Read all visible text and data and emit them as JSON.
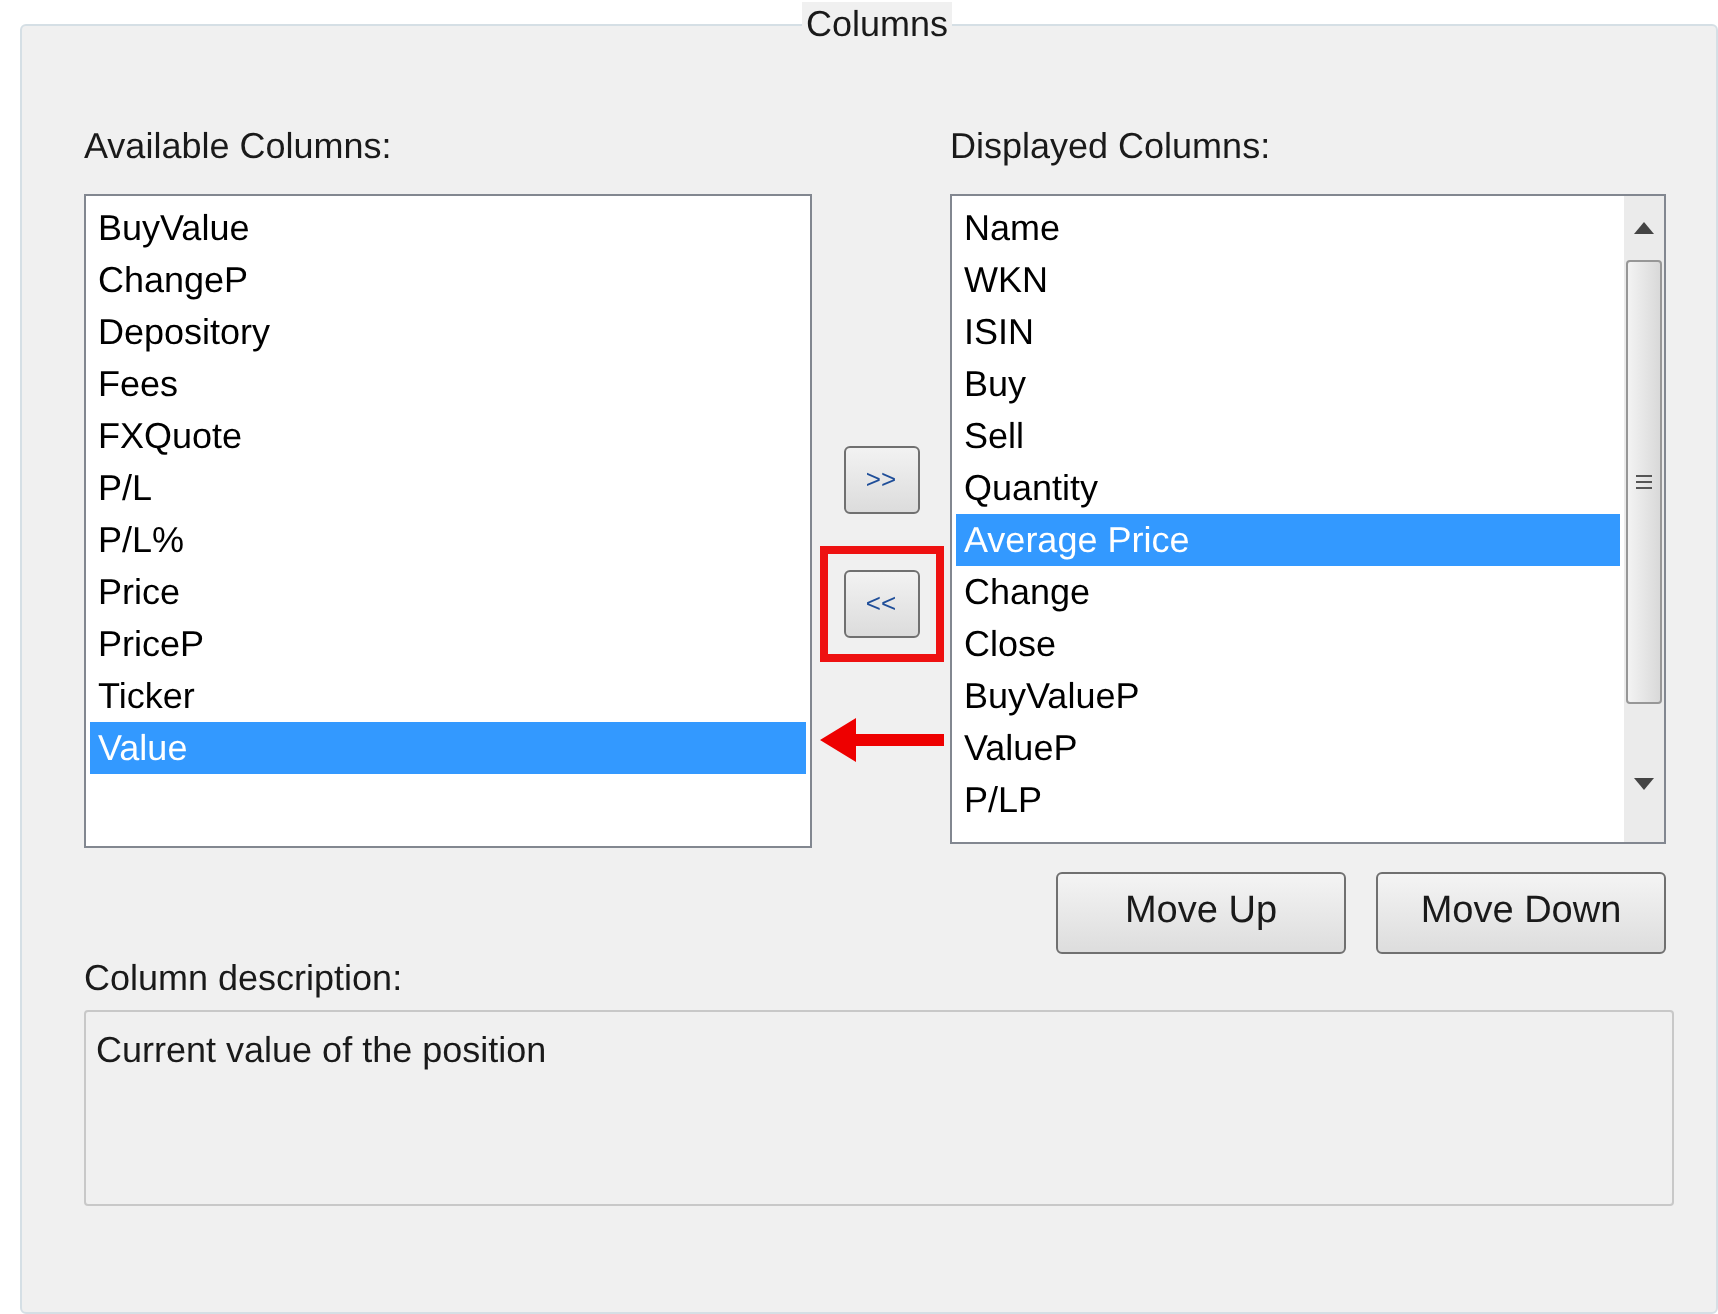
{
  "group_title": "Columns",
  "available": {
    "label": "Available Columns:",
    "items": [
      {
        "label": "BuyValue",
        "selected": false
      },
      {
        "label": "ChangeP",
        "selected": false
      },
      {
        "label": "Depository",
        "selected": false
      },
      {
        "label": "Fees",
        "selected": false
      },
      {
        "label": "FXQuote",
        "selected": false
      },
      {
        "label": "P/L",
        "selected": false
      },
      {
        "label": "P/L%",
        "selected": false
      },
      {
        "label": "Price",
        "selected": false
      },
      {
        "label": "PriceP",
        "selected": false
      },
      {
        "label": "Ticker",
        "selected": false
      },
      {
        "label": "Value",
        "selected": true
      }
    ]
  },
  "transfer_buttons": [
    {
      "label": ">>",
      "highlighted": false
    },
    {
      "label": "<<",
      "highlighted": true
    }
  ],
  "displayed": {
    "label": "Displayed Columns:",
    "items": [
      {
        "label": "Name",
        "selected": false
      },
      {
        "label": "WKN",
        "selected": false
      },
      {
        "label": "ISIN",
        "selected": false
      },
      {
        "label": "Buy",
        "selected": false
      },
      {
        "label": "Sell",
        "selected": false
      },
      {
        "label": "Quantity",
        "selected": false
      },
      {
        "label": "Average Price",
        "selected": true
      },
      {
        "label": "Change",
        "selected": false
      },
      {
        "label": "Close",
        "selected": false
      },
      {
        "label": "BuyValueP",
        "selected": false
      },
      {
        "label": "ValueP",
        "selected": false
      },
      {
        "label": "P/LP",
        "selected": false
      }
    ]
  },
  "order_buttons": [
    "Move Up",
    "Move Down"
  ],
  "description": {
    "label": "Column description:",
    "text": "Current value of the position"
  }
}
